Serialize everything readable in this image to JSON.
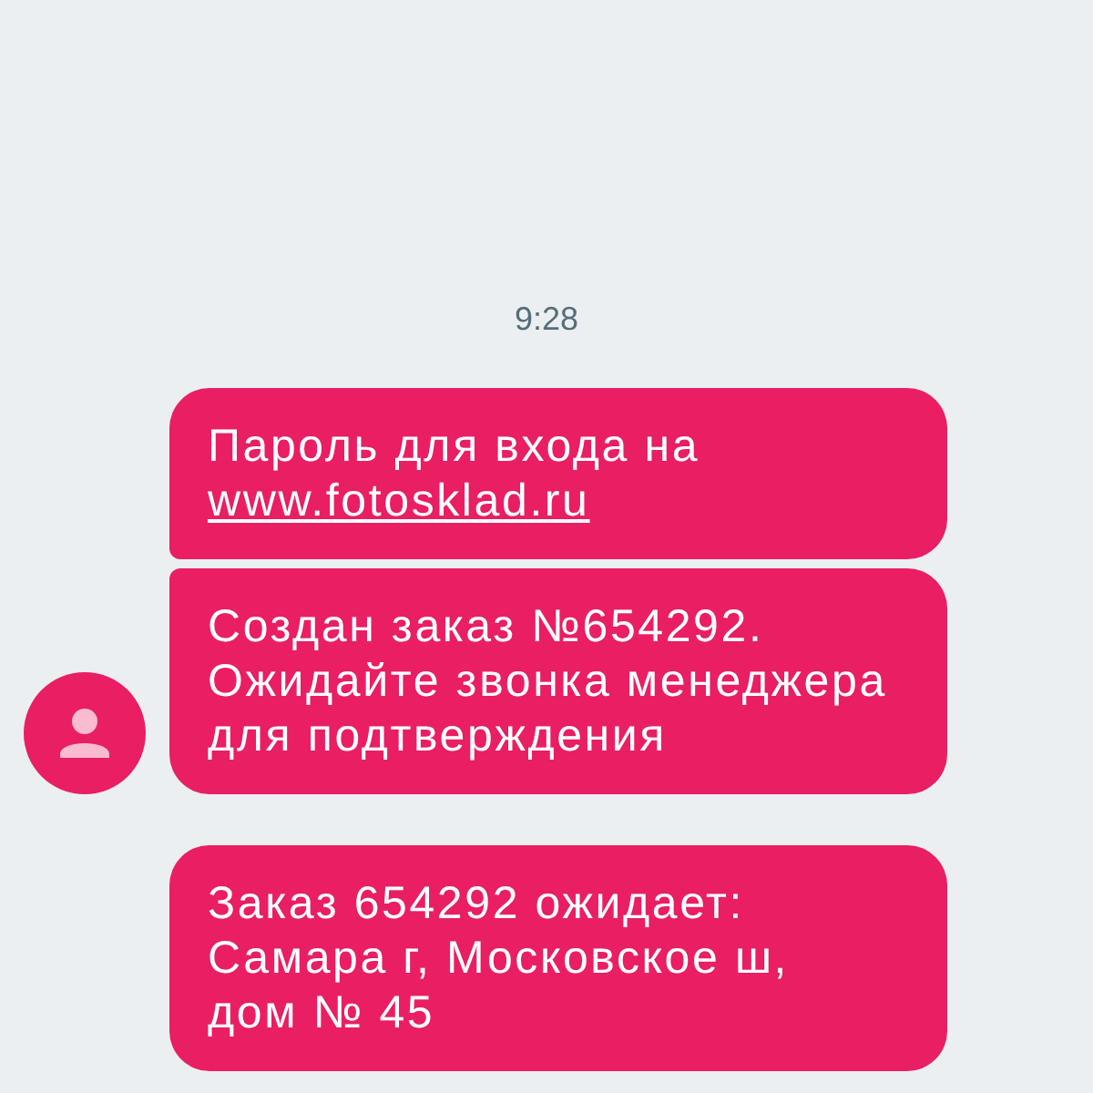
{
  "time": "9:28",
  "groups": [
    {
      "show_avatar": true,
      "messages": [
        {
          "lines": [
            "Пароль для входа на"
          ],
          "link": "www.fotosklad.ru"
        },
        {
          "lines": [
            "Создан заказ №654292.",
            "Ожидайте звонка менеджера",
            "для подтверждения"
          ]
        }
      ]
    },
    {
      "show_avatar": false,
      "messages": [
        {
          "lines": [
            "Заказ 654292 ожидает:",
            "Самара г, Московское ш,",
            "дом № 45"
          ]
        }
      ]
    }
  ]
}
